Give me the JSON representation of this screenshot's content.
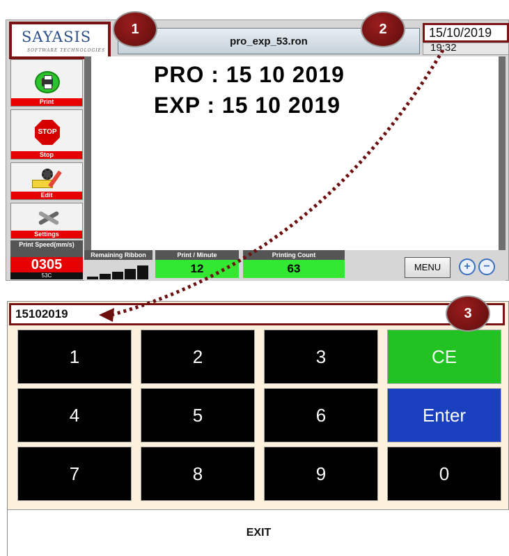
{
  "header": {
    "logo_text": "SAYASIS",
    "logo_subtitle": "SOFTWARE TECHNOLOGIES",
    "filename": "pro_exp_53.ron",
    "date": "15/10/2019",
    "time": "19:32"
  },
  "sidebar": {
    "items": [
      {
        "label": "Print",
        "icon": "printer-icon"
      },
      {
        "label": "Stop",
        "icon": "stop-sign-icon",
        "icon_text": "STOP"
      },
      {
        "label": "Edit",
        "icon": "edit-tools-icon"
      },
      {
        "label": "Settings",
        "icon": "wrench-icon"
      }
    ],
    "speed": {
      "label": "Print Speed(mm/s)",
      "value": "0305",
      "unit": "53C"
    }
  },
  "canvas": {
    "lines": [
      "PRO : 15 10 2019",
      "EXP : 15 10 2019"
    ]
  },
  "status": {
    "ribbon_label": "Remaining Ribbon",
    "ribbon_levels": [
      0.2,
      0.35,
      0.5,
      0.7,
      0.9
    ],
    "ppm_label": "Print / Minute",
    "ppm_value": "12",
    "count_label": "Printing Count",
    "count_value": "63"
  },
  "toolbar": {
    "menu_label": "MENU",
    "zoom_in_icon": "zoom-in-icon",
    "zoom_out_icon": "zoom-out-icon"
  },
  "keypad": {
    "entry_value": "15102019",
    "keys": [
      "1",
      "2",
      "3",
      "CE",
      "4",
      "5",
      "6",
      "Enter",
      "7",
      "8",
      "9",
      "0"
    ],
    "exit_label": "EXIT"
  },
  "callouts": [
    "1",
    "2",
    "3"
  ],
  "colors": {
    "callout": "#7a1414",
    "accent_red": "#e60000",
    "accent_green": "#33e833",
    "enter_blue": "#1a3fbf"
  }
}
